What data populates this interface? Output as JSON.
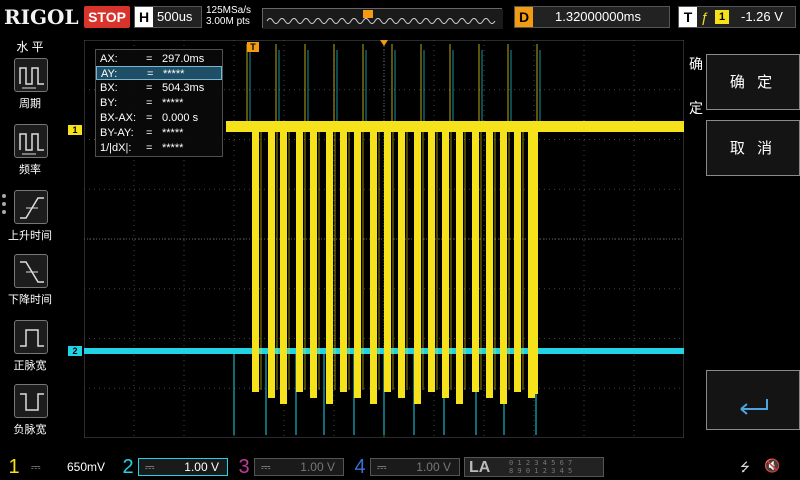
{
  "top": {
    "logo": "RIGOL",
    "run_state": "STOP",
    "horizontal_letter": "H",
    "timebase": "500us",
    "sample_rate": "125MSa/s",
    "memory_depth": "3.00M pts",
    "delay_letter": "D",
    "delay_value": "1.32000000ms",
    "trigger_letter": "T",
    "trigger_edge_symbol": "ƒ",
    "trigger_source": "1",
    "trigger_level": "-1.26 V"
  },
  "left_menu": {
    "title": "水 平",
    "items": [
      {
        "label": "周期",
        "icon": "period-icon"
      },
      {
        "label": "频率",
        "icon": "frequency-icon"
      },
      {
        "label": "上升时间",
        "icon": "rise-time-icon"
      },
      {
        "label": "下降时间",
        "icon": "fall-time-icon"
      },
      {
        "label": "正脉宽",
        "icon": "positive-width-icon"
      },
      {
        "label": "负脉宽",
        "icon": "negative-width-icon"
      }
    ]
  },
  "cursor_panel": {
    "rows": [
      {
        "key": "AX:",
        "eq": "=",
        "value": "297.0ms"
      },
      {
        "key": "AY:",
        "eq": "=",
        "value": "*****"
      },
      {
        "key": "BX:",
        "eq": "=",
        "value": "504.3ms"
      },
      {
        "key": "BY:",
        "eq": "=",
        "value": "*****"
      },
      {
        "key": "BX-AX:",
        "eq": "=",
        "value": "0.000 s"
      },
      {
        "key": "BY-AY:",
        "eq": "=",
        "value": "*****"
      },
      {
        "key": "1/|dX|:",
        "eq": "=",
        "value": "*****"
      }
    ]
  },
  "right_menu": {
    "title": "确定",
    "confirm_label": "确 定",
    "cancel_label": "取 消",
    "enter_icon": "enter-return-icon"
  },
  "markers": {
    "ch1": "1",
    "ch2": "2",
    "trigger": "T"
  },
  "bottom": {
    "channels": [
      {
        "num": "1",
        "coupling": "⎓",
        "value": "650mV",
        "color": "#f5e21b"
      },
      {
        "num": "2",
        "coupling": "⎓",
        "value": "1.00 V",
        "color": "#22d3e6"
      },
      {
        "num": "3",
        "coupling": "⎓",
        "value": "1.00 V",
        "color": "#c03a9a"
      },
      {
        "num": "4",
        "coupling": "⎓",
        "value": "1.00 V",
        "color": "#3a6fd8"
      }
    ],
    "la_label": "LA",
    "la_line1": "0 1 2 3  4 5 6 7",
    "la_line2": "8 9 0 1  2 3 4 5",
    "usb_icon": "usb-icon",
    "speaker_icon": "speaker-mute-icon"
  },
  "colors": {
    "ch1": "#f5e21b",
    "ch2": "#22d3e6",
    "trigger": "#f39c12",
    "stop": "#d9342c"
  }
}
